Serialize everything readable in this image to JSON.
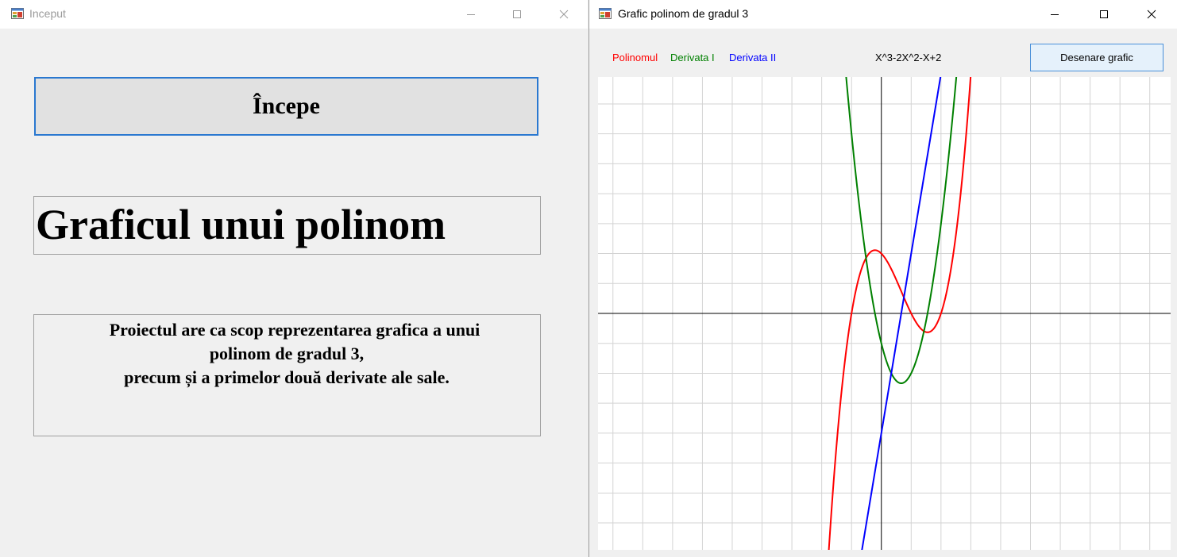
{
  "left_window": {
    "title": "Inceput",
    "start_button_label": "Începe",
    "heading": "Graficul unui polinom",
    "description": {
      "line1": "Proiectul are ca scop reprezentarea grafica a unui",
      "line2": "polinom de gradul 3,",
      "line3": "precum și a primelor două derivate ale sale."
    }
  },
  "right_window": {
    "title": "Grafic polinom de gradul 3",
    "legend": [
      {
        "label": "Polinomul",
        "color": "#ff0000"
      },
      {
        "label": "Derivata I",
        "color": "#008000"
      },
      {
        "label": "Derivata II",
        "color": "#0000ff"
      }
    ],
    "formula": "X^3-2X^2-X+2",
    "draw_button_label": "Desenare grafic"
  },
  "chart_data": {
    "type": "line",
    "series": [
      {
        "name": "Polinomul",
        "expression": "x^3-2x^2-x+2",
        "coefficients": [
          1,
          -2,
          -1,
          2
        ],
        "color": "#ff0000"
      },
      {
        "name": "Derivata I",
        "expression": "3x^2-4x-1",
        "coefficients": [
          0,
          3,
          -4,
          -1
        ],
        "color": "#008000"
      },
      {
        "name": "Derivata II",
        "expression": "6x-4",
        "coefficients": [
          0,
          0,
          6,
          -4
        ],
        "color": "#0000ff"
      }
    ],
    "xlim": [
      -9.5,
      9.7
    ],
    "ylim": [
      -7.9,
      7.9
    ],
    "grid": true,
    "legend_position": "top-left"
  }
}
